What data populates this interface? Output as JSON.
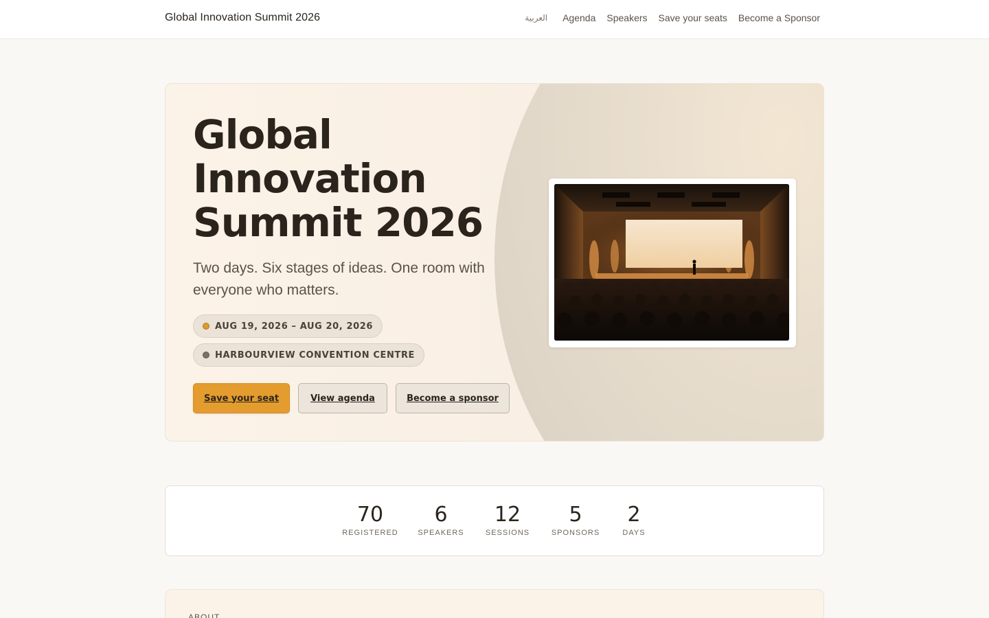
{
  "header": {
    "brand": "Global Innovation Summit 2026",
    "nav": {
      "language": "العربية",
      "agenda": "Agenda",
      "speakers": "Speakers",
      "save_seats": "Save your seats",
      "sponsor": "Become a Sponsor"
    }
  },
  "hero": {
    "title": "Global Innovation Summit 2026",
    "subtitle": "Two days. Six stages of ideas. One room with everyone who matters.",
    "date": "AUG 19, 2026 – AUG 20, 2026",
    "venue": "HARBOURVIEW CONVENTION CENTRE",
    "buttons": {
      "primary": "Save your seat",
      "agenda": "View agenda",
      "sponsor": "Become a sponsor"
    },
    "colors": {
      "accent": "#e59c2e",
      "ink": "#2a241d",
      "hero_bg": "#fcf3e8"
    }
  },
  "stats": [
    {
      "value": "70",
      "label": "REGISTERED"
    },
    {
      "value": "6",
      "label": "SPEAKERS"
    },
    {
      "value": "12",
      "label": "SESSIONS"
    },
    {
      "value": "5",
      "label": "SPONSORS"
    },
    {
      "value": "2",
      "label": "DAYS"
    }
  ],
  "about": {
    "label": "ABOUT"
  }
}
